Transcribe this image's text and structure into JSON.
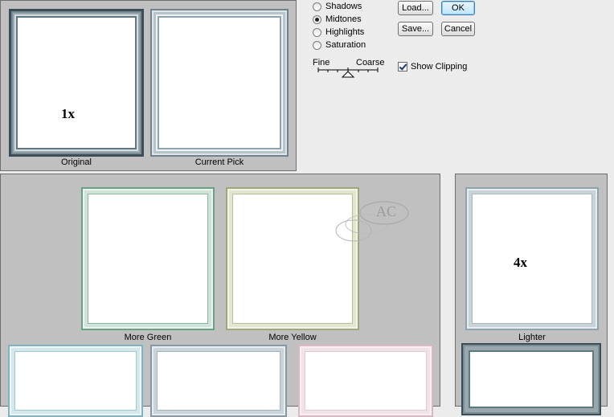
{
  "preview": {
    "zoom_label": "1x",
    "original_label": "Original",
    "current_label": "Current Pick"
  },
  "tone_options": [
    {
      "label": "Shadows",
      "selected": false
    },
    {
      "label": "Midtones",
      "selected": true
    },
    {
      "label": "Highlights",
      "selected": false
    },
    {
      "label": "Saturation",
      "selected": false
    }
  ],
  "slider": {
    "fine_label": "Fine",
    "coarse_label": "Coarse"
  },
  "buttons": {
    "load": "Load...",
    "save": "Save...",
    "ok": "OK",
    "cancel": "Cancel"
  },
  "show_clipping": {
    "label": "Show Clipping",
    "checked": true
  },
  "variations": [
    {
      "label": "More Green"
    },
    {
      "label": "More Yellow"
    }
  ],
  "watermark": "AC",
  "lightness": {
    "zoom_label": "4x",
    "lighter_label": "Lighter"
  },
  "colors": {
    "frame_dark": "#3c4d55",
    "frame_blueish": "#9fb3bd",
    "green": "#6aa084",
    "yellow": "#a2a77a",
    "cyan": "#7fb3c0",
    "pink": "#d9b8c1",
    "panel": "#c0c0c0",
    "ok_border": "#3c7fb1"
  }
}
